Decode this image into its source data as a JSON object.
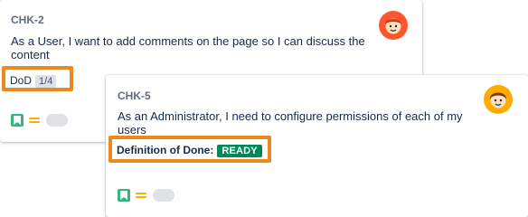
{
  "cards": [
    {
      "key": "CHK-2",
      "summary": "As a User, I want to add comments on the page so I can discuss the content",
      "dod": {
        "label": "DoD",
        "count": "1/4"
      }
    },
    {
      "key": "CHK-5",
      "summary": "As an Administrator, I need to configure permissions of each of my users",
      "dod": {
        "title": "Definition of Done:",
        "status": "READY"
      }
    }
  ],
  "colors": {
    "highlight": "#ea8a1e",
    "story": "#36b37e",
    "priority_medium": "#ffab00",
    "ready": "#00875a"
  },
  "icons": {
    "issue_type": "story-bookmark-icon",
    "priority": "priority-medium-icon",
    "estimate": "story-points-pill",
    "assignee_card_1": "avatar-red-hair-icon",
    "assignee_card_2": "avatar-brown-hair-icon"
  }
}
